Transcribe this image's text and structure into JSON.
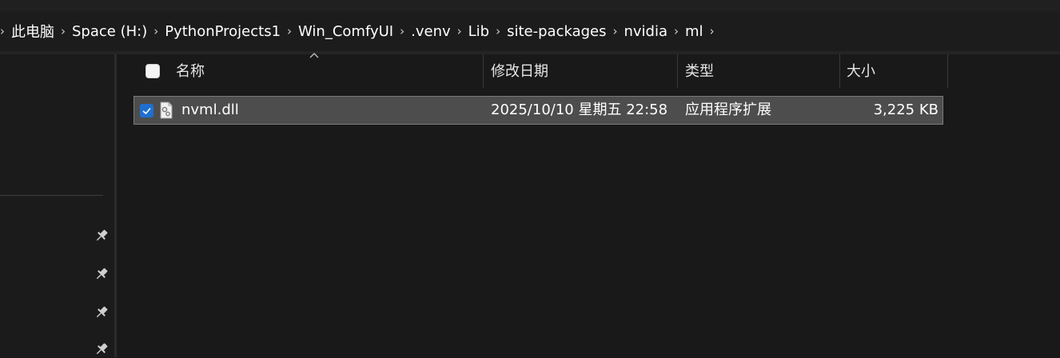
{
  "breadcrumb": {
    "items": [
      "此电脑",
      "Space (H:)",
      "PythonProjects1",
      "Win_ComfyUI",
      ".venv",
      "Lib",
      "site-packages",
      "nvidia",
      "ml"
    ]
  },
  "columns": {
    "name": "名称",
    "date": "修改日期",
    "type": "类型",
    "size": "大小"
  },
  "files": [
    {
      "name": "nvml.dll",
      "date": "2025/10/10 星期五 22:58",
      "type": "应用程序扩展",
      "size": "3,225 KB",
      "selected": true
    }
  ],
  "icons": {
    "separator": "chevron-right-icon",
    "pin": "pin-icon",
    "file": "dll-file-icon",
    "sort": "sort-up-icon"
  },
  "colors": {
    "background": "#191919",
    "selection": "#4d4d4d",
    "accent": "#1f6fd1"
  }
}
